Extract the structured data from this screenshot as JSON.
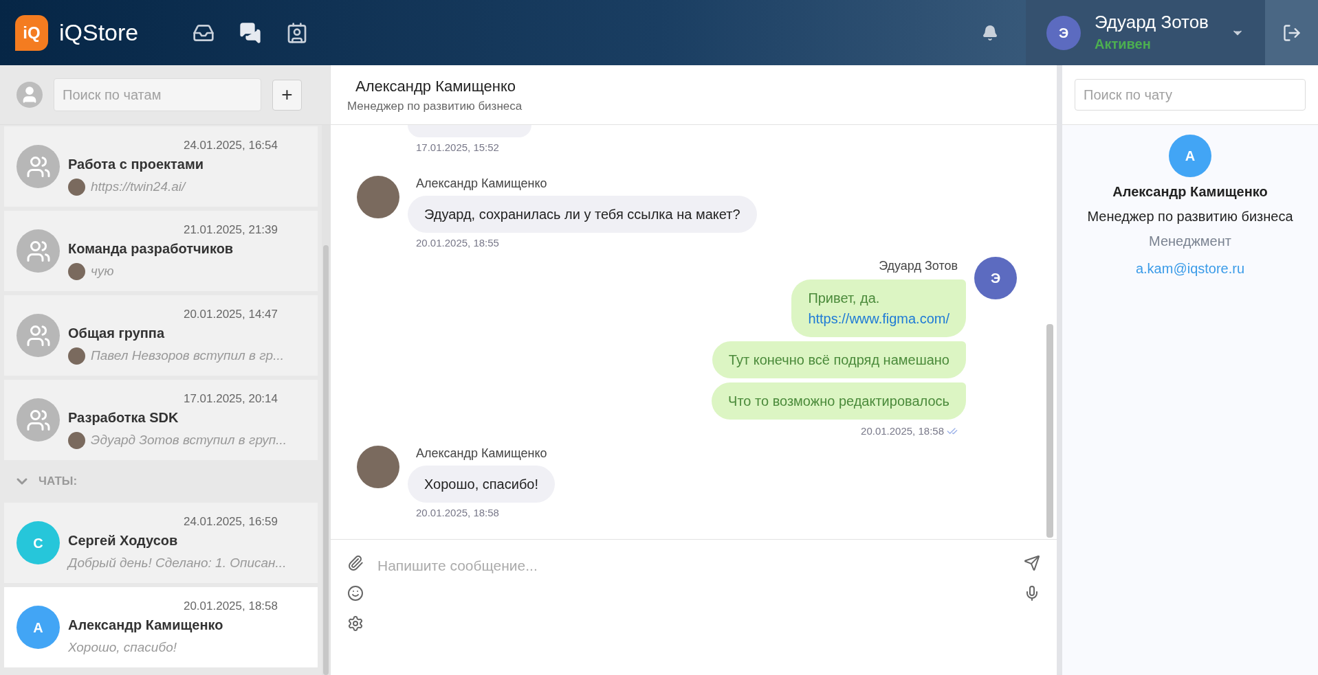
{
  "header": {
    "logo_text": "iQ",
    "app_name": "iQStore",
    "user": {
      "initial": "Э",
      "name": "Эдуард Зотов",
      "status": "Активен"
    }
  },
  "sidebar": {
    "search_placeholder": "Поиск по чатам",
    "add_label": "+",
    "groups": [
      {
        "date": "24.01.2025, 16:54",
        "name": "Работа с проектами",
        "preview": "https://twin24.ai/",
        "selected": false
      },
      {
        "date": "21.01.2025, 21:39",
        "name": "Команда разработчиков",
        "preview": "чую",
        "selected": false
      },
      {
        "date": "20.01.2025, 14:47",
        "name": "Общая группа",
        "preview": "Павел Невзоров вступил в гр...",
        "selected": false
      },
      {
        "date": "17.01.2025, 20:14",
        "name": "Разработка SDK",
        "preview": "Эдуард Зотов вступил в груп...",
        "selected": false
      }
    ],
    "section": {
      "label": "ЧАТЫ:",
      "expanded": true
    },
    "chats": [
      {
        "initial": "С",
        "color": "#26c6da",
        "date": "24.01.2025, 16:59",
        "name": "Сергей Ходусов",
        "preview": "Добрый день! Сделано: 1. Описан...",
        "selected": false
      },
      {
        "initial": "А",
        "color": "#42a5f5",
        "date": "20.01.2025, 18:58",
        "name": "Александр Камищенко",
        "preview": "Хорошо, спасибо!",
        "selected": true
      }
    ]
  },
  "chat": {
    "title": "Александр Камищенко",
    "subtitle": "Менеджер по развитию бизнеса",
    "messages": [
      {
        "kind": "incoming",
        "time": "17.01.2025, 15:52"
      },
      {
        "kind": "incoming",
        "sender": "Александр Камищенко",
        "bubbles": [
          {
            "text": "Эдуард, сохранилась ли у тебя ссылка на макет?"
          }
        ],
        "time": "20.01.2025, 18:55"
      },
      {
        "kind": "outgoing",
        "sender": "Эдуард Зотов",
        "initial": "Э",
        "bubbles": [
          {
            "text": "Привет, да.",
            "link": "https://www.figma.com/"
          },
          {
            "text": "Тут конечно всё подряд намешано"
          },
          {
            "text": "Что то возможно редактировалось"
          }
        ],
        "time": "20.01.2025, 18:58",
        "read": true
      },
      {
        "kind": "incoming",
        "sender": "Александр Камищенко",
        "bubbles": [
          {
            "text": "Хорошо, спасибо!"
          }
        ],
        "time": "20.01.2025, 18:58"
      }
    ],
    "composer": {
      "placeholder": "Напишите сообщение..."
    }
  },
  "info": {
    "search_placeholder": "Поиск по чату",
    "initial": "А",
    "color": "#42a5f5",
    "name": "Александр Камищенко",
    "position": "Менеджер по развитию бизнеса",
    "department": "Менеджмент",
    "email": "a.kam@iqstore.ru"
  }
}
